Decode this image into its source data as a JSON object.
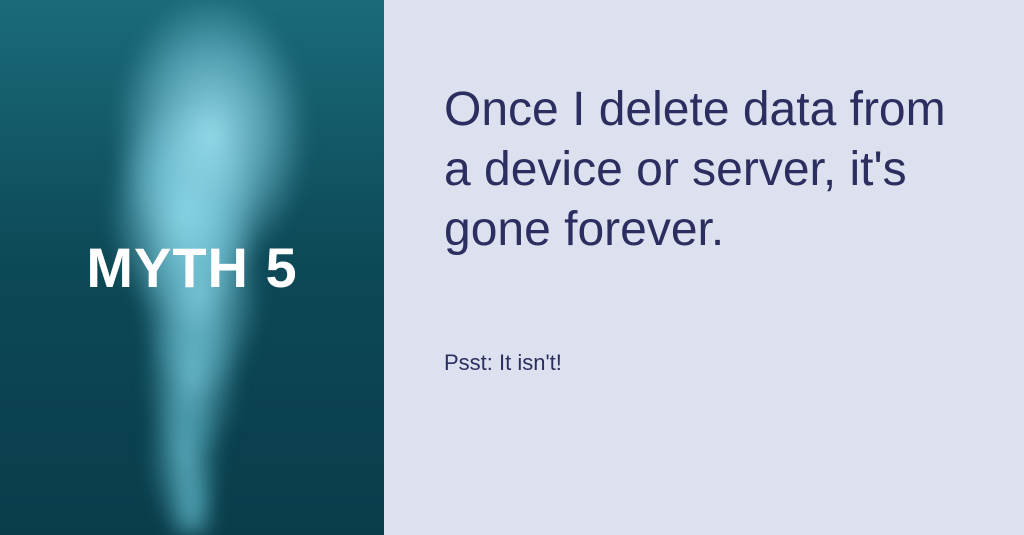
{
  "left": {
    "label": "MYTH 5"
  },
  "right": {
    "statement": "Once I delete data from a device or server, it's gone forever.",
    "response": "Psst: It isn't!"
  },
  "colors": {
    "rightBg": "#dde1ef",
    "textDark": "#2b2e5e",
    "leftBgTop": "#1a6b7a",
    "leftBgBottom": "#0a3d4a"
  }
}
